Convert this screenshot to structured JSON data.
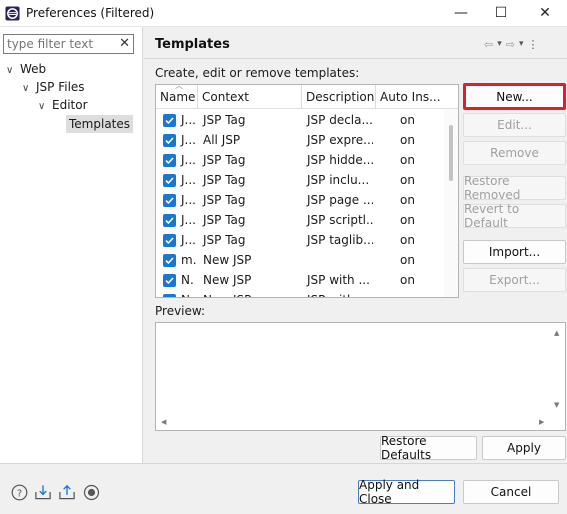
{
  "window": {
    "title": "Preferences (Filtered)",
    "minimize": "—",
    "maximize": "☐",
    "close": "✕"
  },
  "sidebar": {
    "filter_placeholder": "type filter text",
    "filter_clear": "✕",
    "tree": [
      {
        "label": "Web",
        "toggle": "∨",
        "level": 0
      },
      {
        "label": "JSP Files",
        "toggle": "∨",
        "level": 1
      },
      {
        "label": "Editor",
        "toggle": "∨",
        "level": 2
      },
      {
        "label": "Templates",
        "toggle": "",
        "level": 3,
        "selected": true
      }
    ]
  },
  "main": {
    "title": "Templates",
    "nav": {
      "back": "⇦",
      "back_menu": "▾",
      "forward": "⇨",
      "forward_menu": "▾",
      "more": "⋮"
    },
    "description": "Create, edit or remove templates:",
    "table": {
      "columns": [
        "Name",
        "Context",
        "Description",
        "Auto Ins..."
      ],
      "rows": [
        {
          "checked": true,
          "name": "J...",
          "context": "JSP Tag",
          "description": "JSP decla...",
          "auto": "on"
        },
        {
          "checked": true,
          "name": "J...",
          "context": "All JSP",
          "description": "JSP expre...",
          "auto": "on"
        },
        {
          "checked": true,
          "name": "J...",
          "context": "JSP Tag",
          "description": "JSP hidde...",
          "auto": "on"
        },
        {
          "checked": true,
          "name": "J...",
          "context": "JSP Tag",
          "description": "JSP inclu...",
          "auto": "on"
        },
        {
          "checked": true,
          "name": "J...",
          "context": "JSP Tag",
          "description": "JSP page ...",
          "auto": "on"
        },
        {
          "checked": true,
          "name": "J...",
          "context": "JSP Tag",
          "description": "JSP scriptl...",
          "auto": "on"
        },
        {
          "checked": true,
          "name": "J...",
          "context": "JSP Tag",
          "description": "JSP taglib...",
          "auto": "on"
        },
        {
          "checked": true,
          "name": "m.",
          "context": "New JSP",
          "description": "",
          "auto": "on"
        },
        {
          "checked": true,
          "name": "N.",
          "context": "New JSP",
          "description": "JSP with ...",
          "auto": "on"
        },
        {
          "checked": true,
          "name": "N.",
          "context": "New JSP",
          "description": "JSP with ...",
          "auto": "on"
        }
      ]
    },
    "buttons": {
      "new": "New...",
      "edit": "Edit...",
      "remove": "Remove",
      "restore_removed": "Restore Removed",
      "revert_default": "Revert to Default",
      "import": "Import...",
      "export": "Export..."
    },
    "preview_label": "Preview:",
    "restore_defaults": "Restore Defaults",
    "apply": "Apply"
  },
  "footer": {
    "apply_close": "Apply and Close",
    "cancel": "Cancel",
    "icons": [
      "help-icon",
      "import-preferences-icon",
      "export-preferences-icon",
      "record-icon"
    ]
  },
  "colors": {
    "accent_checkbox": "#1976d2",
    "highlight_border": "#e11d2a"
  }
}
